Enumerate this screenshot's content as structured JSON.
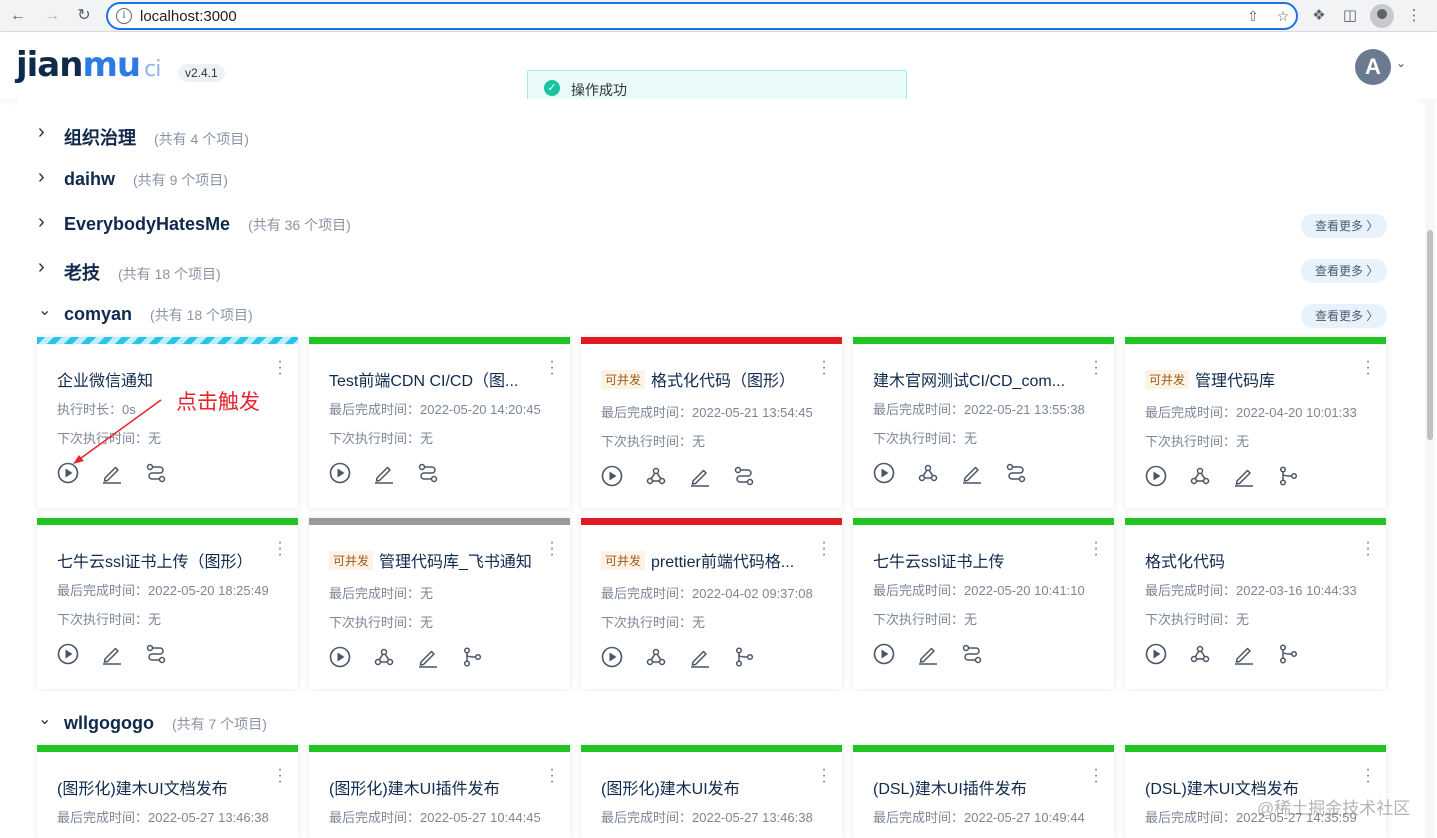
{
  "browser": {
    "url": "localhost:3000",
    "back_icon": "arrow-left-icon",
    "forward_icon": "arrow-right-icon",
    "reload_icon": "reload-icon",
    "info_icon": "info-icon"
  },
  "header": {
    "logo_main": "jian",
    "logo_mu": "mu",
    "logo_ci": "ci",
    "version": "v2.4.1",
    "avatar_letter": "A"
  },
  "toast": {
    "message": "操作成功",
    "color": "#19c3a2"
  },
  "groups": [
    {
      "name": "组织治理",
      "count": "(共有 4 个项目)",
      "expanded": false,
      "more": ""
    },
    {
      "name": "daihw",
      "count": "(共有 9 个项目)",
      "expanded": false,
      "more": ""
    },
    {
      "name": "EverybodyHatesMe",
      "count": "(共有 36 个项目)",
      "expanded": false,
      "more": "查看更多 〉"
    },
    {
      "name": "老技",
      "count": "(共有 18 个项目)",
      "expanded": false,
      "more": "查看更多 〉"
    },
    {
      "name": "comyan",
      "count": "(共有 18 个项目)",
      "expanded": true,
      "more": "查看更多 〉"
    },
    {
      "name": "wllgogogo",
      "count": "(共有 7 个项目)",
      "expanded": true,
      "more": ""
    }
  ],
  "cards": [
    {
      "title": "企业微信通知",
      "tag": "",
      "status": "running",
      "line1": "执行时长：0s",
      "line2": "下次执行时间：无",
      "actions": [
        "play",
        "edit",
        "flow"
      ]
    },
    {
      "title": "Test前端CDN CI/CD（图...",
      "tag": "",
      "status": "success",
      "line1": "最后完成时间：2022-05-20 14:20:45",
      "line2": "下次执行时间：无",
      "actions": [
        "play",
        "edit",
        "flow"
      ]
    },
    {
      "title": "格式化代码（图形）",
      "tag": "可并发",
      "status": "failed",
      "line1": "最后完成时间：2022-05-21 13:54:45",
      "line2": "下次执行时间：无",
      "actions": [
        "play",
        "webhook",
        "edit",
        "flow"
      ]
    },
    {
      "title": "建木官网测试CI/CD_com...",
      "tag": "",
      "status": "success",
      "line1": "最后完成时间：2022-05-21 13:55:38",
      "line2": "下次执行时间：无",
      "actions": [
        "play",
        "webhook",
        "edit",
        "flow"
      ]
    },
    {
      "title": "管理代码库",
      "tag": "可并发",
      "status": "success",
      "line1": "最后完成时间：2022-04-20 10:01:33",
      "line2": "下次执行时间：无",
      "actions": [
        "play",
        "webhook",
        "edit",
        "branch"
      ]
    },
    {
      "title": "七牛云ssl证书上传（图形）",
      "tag": "",
      "status": "success",
      "line1": "最后完成时间：2022-05-20 18:25:49",
      "line2": "下次执行时间：无",
      "actions": [
        "play",
        "edit",
        "flow"
      ]
    },
    {
      "title": "管理代码库_飞书通知",
      "tag": "可并发",
      "status": "init",
      "line1": "最后完成时间：无",
      "line2": "下次执行时间：无",
      "actions": [
        "play",
        "webhook",
        "edit",
        "branch"
      ]
    },
    {
      "title": "prettier前端代码格...",
      "tag": "可并发",
      "status": "failed",
      "line1": "最后完成时间：2022-04-02 09:37:08",
      "line2": "下次执行时间：无",
      "actions": [
        "play",
        "webhook",
        "edit",
        "branch"
      ]
    },
    {
      "title": "七牛云ssl证书上传",
      "tag": "",
      "status": "success",
      "line1": "最后完成时间：2022-05-20 10:41:10",
      "line2": "下次执行时间：无",
      "actions": [
        "play",
        "edit",
        "flow"
      ]
    },
    {
      "title": "格式化代码",
      "tag": "",
      "status": "success",
      "line1": "最后完成时间：2022-03-16 10:44:33",
      "line2": "下次执行时间：无",
      "actions": [
        "play",
        "webhook",
        "edit",
        "branch"
      ]
    },
    {
      "title": "(图形化)建木UI文档发布",
      "tag": "",
      "status": "success",
      "line1": "最后完成时间：2022-05-27 13:46:38",
      "line2": "",
      "actions": []
    },
    {
      "title": "(图形化)建木UI插件发布",
      "tag": "",
      "status": "success",
      "line1": "最后完成时间：2022-05-27 10:44:45",
      "line2": "",
      "actions": []
    },
    {
      "title": "(图形化)建木UI发布",
      "tag": "",
      "status": "success",
      "line1": "最后完成时间：2022-05-27 13:46:38",
      "line2": "",
      "actions": []
    },
    {
      "title": "(DSL)建木UI插件发布",
      "tag": "",
      "status": "success",
      "line1": "最后完成时间：2022-05-27 10:49:44",
      "line2": "",
      "actions": []
    },
    {
      "title": "(DSL)建木UI文档发布",
      "tag": "",
      "status": "success",
      "line1": "最后完成时间：2022-05-27 14:35:59",
      "line2": "",
      "actions": []
    }
  ],
  "annotation": {
    "text": "点击触发",
    "color": "#e8242c"
  },
  "watermark": "@稀土掘金技术社区",
  "colors": {
    "success": "#22c322",
    "failed": "#e01b24",
    "init": "#9a9a9a",
    "running": "#27c5e8",
    "brand": "#2c7be5"
  }
}
